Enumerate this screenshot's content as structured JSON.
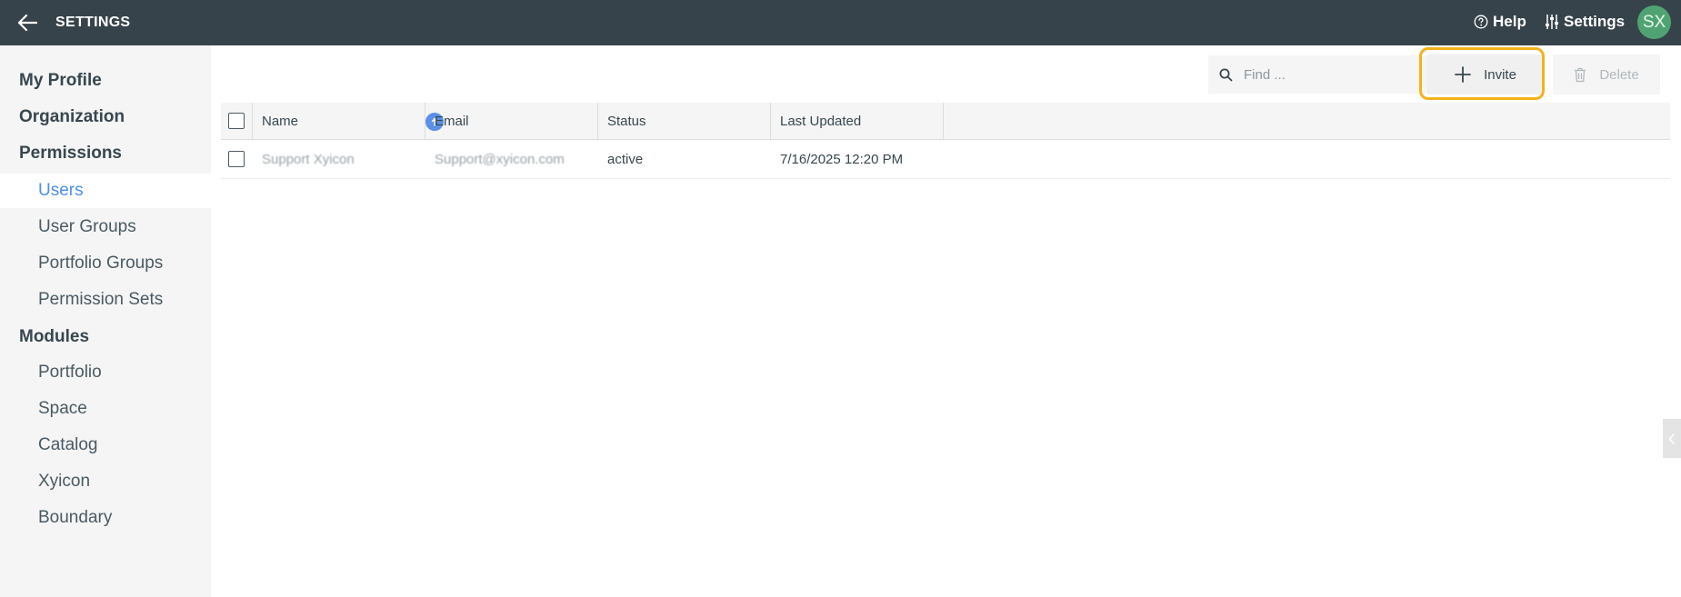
{
  "header": {
    "title": "SETTINGS",
    "help_label": "Help",
    "settings_label": "Settings",
    "avatar_initials": "SX"
  },
  "sidebar": {
    "sections": [
      {
        "label": "My Profile"
      },
      {
        "label": "Organization"
      },
      {
        "label": "Permissions"
      },
      {
        "label": "Modules"
      }
    ],
    "permissions_items": [
      {
        "label": "Users",
        "active": true
      },
      {
        "label": "User Groups"
      },
      {
        "label": "Portfolio Groups"
      },
      {
        "label": "Permission Sets"
      }
    ],
    "modules_items": [
      {
        "label": "Portfolio"
      },
      {
        "label": "Space"
      },
      {
        "label": "Catalog"
      },
      {
        "label": "Xyicon"
      },
      {
        "label": "Boundary"
      }
    ]
  },
  "toolbar": {
    "find_placeholder": "Find ...",
    "invite_label": "Invite",
    "delete_label": "Delete"
  },
  "table": {
    "columns": [
      "Name",
      "Email",
      "Status",
      "Last Updated"
    ],
    "rows": [
      {
        "name": "Support Xyicon",
        "email": "Support@xyicon.com",
        "status": "active",
        "last_updated": "7/16/2025 12:20 PM"
      }
    ]
  },
  "colors": {
    "topbar": "#37434a",
    "accent": "#4d8fe6",
    "highlight": "#f2b21b",
    "avatar": "#4fa373"
  }
}
